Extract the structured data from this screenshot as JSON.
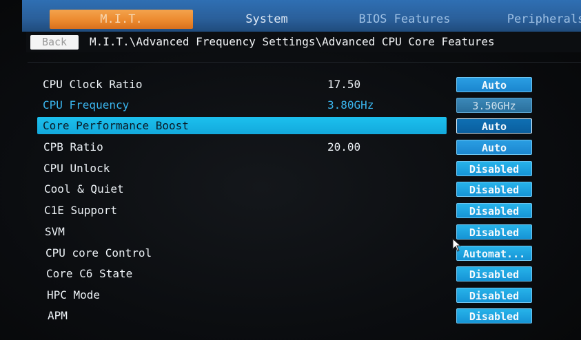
{
  "tabs": [
    {
      "label": "M.I.T.",
      "active": true
    },
    {
      "label": "System",
      "active": false
    },
    {
      "label": "BIOS Features",
      "active": false
    },
    {
      "label": "Peripherals",
      "active": false
    }
  ],
  "navigation": {
    "back_label": "Back",
    "breadcrumb": "M.I.T.\\Advanced Frequency Settings\\Advanced CPU Core Features"
  },
  "settings": [
    {
      "label": "CPU Clock Ratio",
      "current": "17.50",
      "value": "Auto"
    },
    {
      "label": "CPU Frequency",
      "current": "3.80GHz",
      "value": "3.50GHz"
    },
    {
      "label": "Core Performance Boost",
      "current": "",
      "value": "Auto"
    },
    {
      "label": "CPB Ratio",
      "current": "20.00",
      "value": "Auto"
    },
    {
      "label": "CPU Unlock",
      "current": "",
      "value": "Disabled"
    },
    {
      "label": "Cool & Quiet",
      "current": "",
      "value": "Disabled"
    },
    {
      "label": "C1E Support",
      "current": "",
      "value": "Disabled"
    },
    {
      "label": "SVM",
      "current": "",
      "value": "Disabled"
    },
    {
      "label": "CPU core Control",
      "current": "",
      "value": "Automat..."
    },
    {
      "label": "Core C6 State",
      "current": "",
      "value": "Disabled"
    },
    {
      "label": "HPC Mode",
      "current": "",
      "value": "Disabled"
    },
    {
      "label": "APM",
      "current": "",
      "value": "Disabled"
    }
  ],
  "colors": {
    "tab_bar": "#2f6fb3",
    "active_tab": "#ec8a2f",
    "highlight": "#1cc0ee",
    "value_button": "#1b86cf",
    "info_text": "#3ab6ef"
  },
  "icons": {
    "pointer": "mouse-pointer-icon"
  }
}
